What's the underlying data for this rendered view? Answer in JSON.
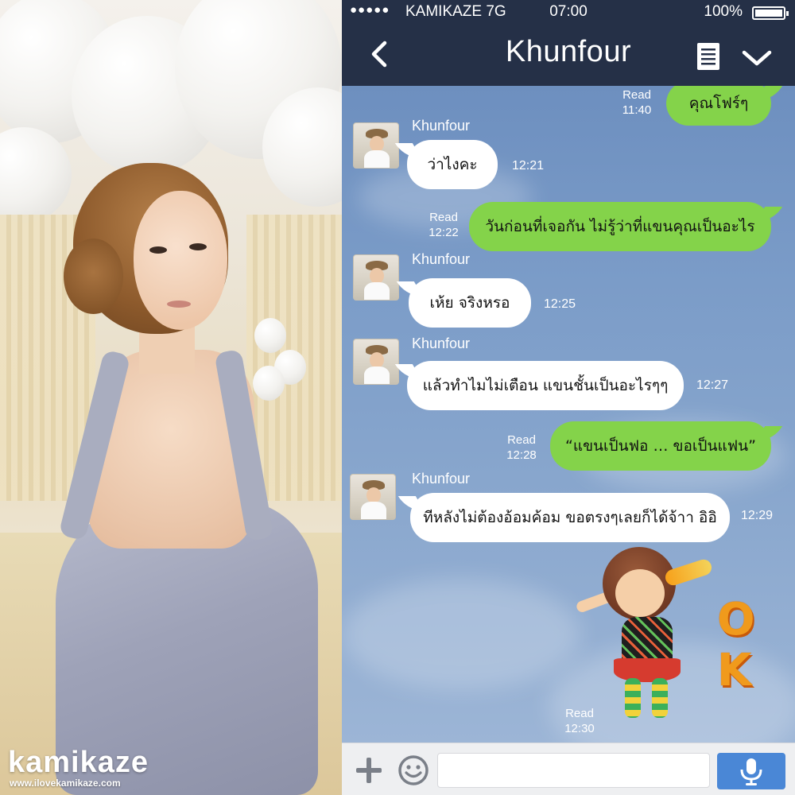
{
  "photo": {
    "logo_text": "kamikaze",
    "logo_url": "www.ilovekamikaze.com"
  },
  "statusbar": {
    "signal": "●●●●●",
    "carrier": "KAMIKAZE  7G",
    "time": "07:00",
    "battery": "100%"
  },
  "navbar": {
    "title": "Khunfour",
    "back_icon": "chevron-left-icon",
    "notes_icon": "notes-icon",
    "expand_icon": "chevron-down-icon"
  },
  "messages": [
    {
      "dir": "out",
      "text": "คุณโฟร์ๆ",
      "status": "Read",
      "time": "11:40"
    },
    {
      "dir": "in",
      "sender": "Khunfour",
      "text": "ว่าไงคะ",
      "time": "12:21"
    },
    {
      "dir": "out",
      "text": "วันก่อนที่เจอกัน ไม่รู้ว่าที่แขนคุณเป็นอะไร",
      "status": "Read",
      "time": "12:22"
    },
    {
      "dir": "in",
      "sender": "Khunfour",
      "text": "เห้ย จริงหรอ",
      "time": "12:25"
    },
    {
      "dir": "in",
      "sender": "Khunfour",
      "text": "แล้วทำไมไม่เตือน แขนชั้นเป็นอะไรๆๆ",
      "time": "12:27"
    },
    {
      "dir": "out",
      "text": "“แขนเป็นฟอ … ขอเป็นแฟน”",
      "status": "Read",
      "time": "12:28"
    },
    {
      "dir": "in",
      "sender": "Khunfour",
      "text": "ทีหลังไม่ต้องอ้อมค้อม ขอตรงๆเลยก็ได้จ้าา อิอิ",
      "time": "12:29"
    },
    {
      "dir": "out",
      "type": "sticker",
      "sticker_text": "OK",
      "status": "Read",
      "time": "12:30"
    }
  ],
  "inputbar": {
    "plus_icon": "plus-icon",
    "emoji_icon": "emoji-icon",
    "placeholder": "",
    "mic_icon": "microphone-icon"
  },
  "colors": {
    "header": "#253047",
    "outgoing_bubble": "#84d34a",
    "incoming_bubble": "#ffffff",
    "chat_background": "#7b9cc8",
    "mic_button": "#4a87d6"
  }
}
